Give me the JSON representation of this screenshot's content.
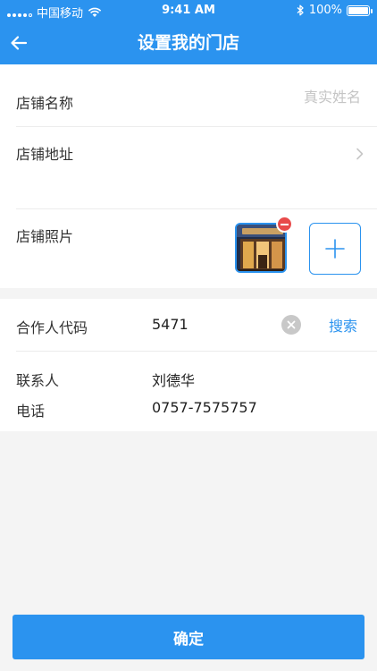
{
  "status_bar": {
    "carrier": "中国移动",
    "time": "9:41 AM",
    "battery_percent": "100%",
    "battery_level": 1.0,
    "icons": [
      "signal-icon",
      "wifi-icon",
      "bluetooth-icon",
      "battery-icon"
    ]
  },
  "nav": {
    "title": "设置我的门店",
    "back_icon": "arrow-left-icon"
  },
  "form": {
    "name_label": "店铺名称",
    "name_value": "",
    "name_placeholder": "真实姓名",
    "address_label": "店铺地址",
    "address_icon": "chevron-right-icon",
    "photo_label": "店铺照片",
    "photo_icons": [
      "store-photo-thumbnail",
      "remove-icon",
      "plus-icon"
    ]
  },
  "partner": {
    "code_label": "合作人代码",
    "code_value": "5471",
    "clear_icon": "clear-icon",
    "search_label": "搜索",
    "contact_label": "联系人",
    "contact_value": "刘德华",
    "phone_label": "电话",
    "phone_value": "0757-7575757"
  },
  "footer": {
    "confirm_label": "确定"
  },
  "colors": {
    "primary": "#2b93ef",
    "danger": "#e84a4a",
    "background": "#f4f4f4"
  }
}
